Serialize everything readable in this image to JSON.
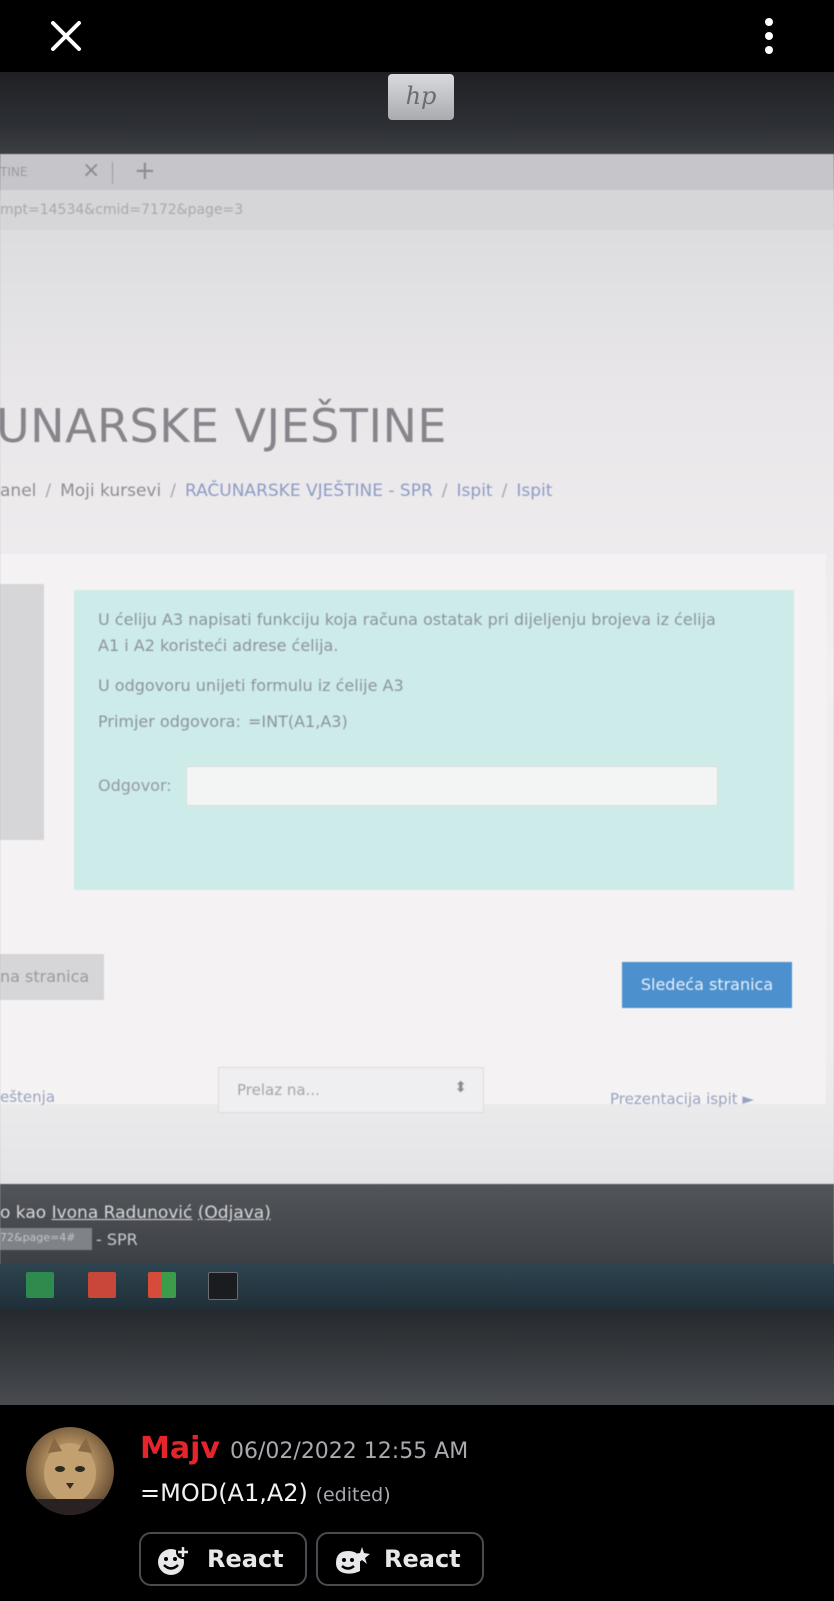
{
  "overlay": {
    "close_icon": "close-icon",
    "more_icon": "more-vertical-icon"
  },
  "photo": {
    "brand_logo_text": "hp",
    "browser": {
      "tab_label": "TINE",
      "url_fragment": "mpt=14534&cmid=7172&page=3"
    },
    "page": {
      "title": "UNARSKE VJEŠTINE",
      "breadcrumb": [
        "anel",
        "Moji kursevi",
        "RAČUNARSKE VJEŠTINE - SPR",
        "Ispit",
        "Ispit"
      ],
      "question": {
        "line1": "U ćeliju A3 napisati funkciju koja računa ostatak pri dijeljenju brojeva iz ćelija",
        "line2": "A1 i A2 koristeći adrese ćelija.",
        "line3": "U odgovoru unijeti formulu iz ćelije A3",
        "example_label": "Primjer odgovora:",
        "example_value": "=INT(A1,A3)",
        "answer_label": "Odgovor:",
        "answer_value": ""
      },
      "prev_button": "na stranica",
      "next_button": "Sledeća stranica",
      "quiz_nav": "eštenja",
      "jump_placeholder": "Prelaz na...",
      "next_activity": "Prezentacija ispit ►",
      "logged_in_prefix": "o kao ",
      "logged_in_user": "Ivona Radunović",
      "logout_link": "(Odjava)",
      "status_url": "72&page=4#",
      "status_suffix": "- SPR"
    },
    "taskbar_icons": [
      "excel-icon",
      "powerpoint-icon",
      "windows-store-icon",
      "terminal-icon"
    ]
  },
  "chat": {
    "username": "Majv",
    "timestamp": "06/02/2022 12:55 AM",
    "message": "=MOD(A1,A2)",
    "edited": "(edited)",
    "react_buttons": [
      "React",
      "React"
    ],
    "colors": {
      "username": "#e5252b",
      "background": "#000000"
    }
  }
}
